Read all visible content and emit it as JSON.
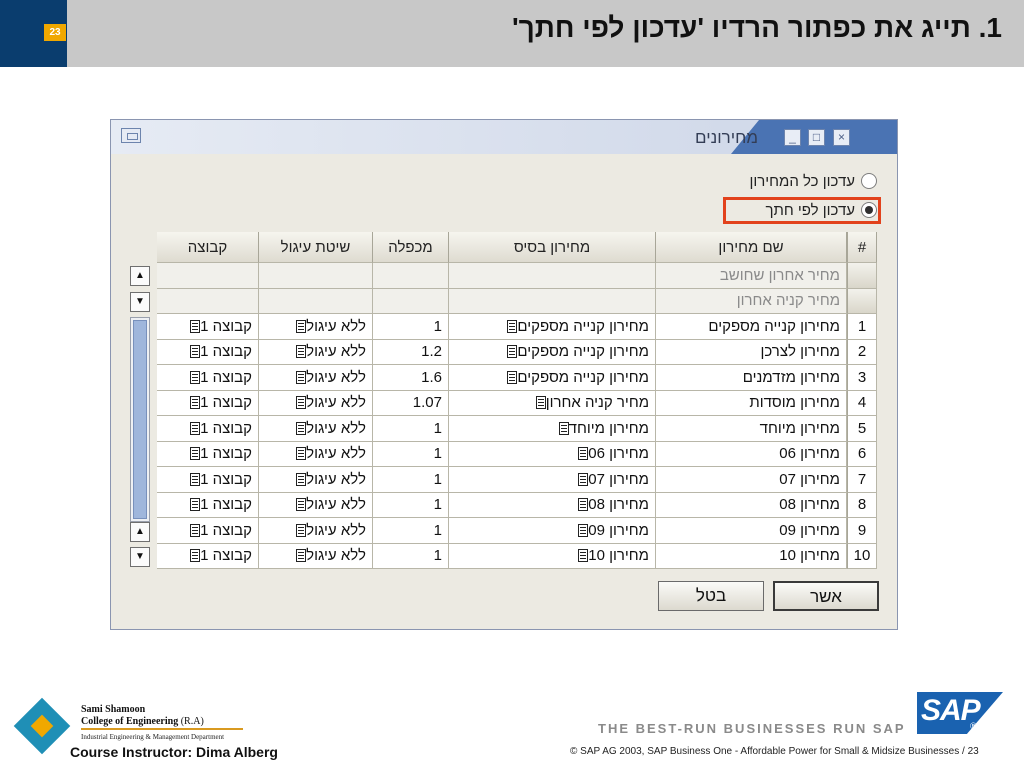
{
  "slide": {
    "page_number": "23",
    "title": "1. תייג את כפתור הרדיו 'עדכון לפי חתך'"
  },
  "window": {
    "title": "מחירונים",
    "minimize_icon": "minimize-icon",
    "restore_icon": "restore-icon",
    "close_icon": "close-icon",
    "radio_options": [
      {
        "label": "עדכון כל המחירון",
        "selected": false
      },
      {
        "label": "עדכון לפי חתך",
        "selected": true
      }
    ],
    "highlight_color": "#e2421c"
  },
  "grid": {
    "headers": {
      "num": "#",
      "name": "שם מחירון",
      "base": "מחירון בסיס",
      "factor": "מכפלה",
      "rounding": "שיטת עיגול",
      "group": "קבוצה"
    },
    "special_rows": [
      {
        "name": "מחיר אחרון שחושב"
      },
      {
        "name": "מחיר קניה אחרון"
      }
    ],
    "rows": [
      {
        "num": "1",
        "name": "מחירון קנייה מספקים",
        "base": "מחירון קנייה מספקים",
        "factor": "1",
        "rounding": "ללא עיגול",
        "group": "קבוצה 1"
      },
      {
        "num": "2",
        "name": "מחירון לצרכן",
        "base": "מחירון קנייה מספקים",
        "factor": "1.2",
        "rounding": "ללא עיגול",
        "group": "קבוצה 1"
      },
      {
        "num": "3",
        "name": "מחירון מזדמנים",
        "base": "מחירון קנייה מספקים",
        "factor": "1.6",
        "rounding": "ללא עיגול",
        "group": "קבוצה 1"
      },
      {
        "num": "4",
        "name": "מחירון מוסדות",
        "base": "מחיר קניה אחרון",
        "factor": "1.07",
        "rounding": "ללא עיגול",
        "group": "קבוצה 1"
      },
      {
        "num": "5",
        "name": "מחירון מיוחד",
        "base": "מחירון מיוחד",
        "factor": "1",
        "rounding": "ללא עיגול",
        "group": "קבוצה 1"
      },
      {
        "num": "6",
        "name": "מחירון 06",
        "base": "מחירון 06",
        "factor": "1",
        "rounding": "ללא עיגול",
        "group": "קבוצה 1"
      },
      {
        "num": "7",
        "name": "מחירון 07",
        "base": "מחירון 07",
        "factor": "1",
        "rounding": "ללא עיגול",
        "group": "קבוצה 1"
      },
      {
        "num": "8",
        "name": "מחירון 08",
        "base": "מחירון 08",
        "factor": "1",
        "rounding": "ללא עיגול",
        "group": "קבוצה 1"
      },
      {
        "num": "9",
        "name": "מחירון 09",
        "base": "מחירון 09",
        "factor": "1",
        "rounding": "ללא עיגול",
        "group": "קבוצה 1"
      },
      {
        "num": "10",
        "name": "מחירון 10",
        "base": "מחירון 10",
        "factor": "1",
        "rounding": "ללא עיגול",
        "group": "קבוצה 1"
      }
    ]
  },
  "buttons": {
    "ok": "אשר",
    "cancel": "בטל"
  },
  "footer": {
    "author": "Sami Shamoon",
    "college": "College of Engineering",
    "college_suffix": "(R.A)",
    "department": "Industrial Engineering & Management Department",
    "instructor": "Course Instructor: Dima Alberg",
    "tagline": "THE BEST-RUN BUSINESSES RUN SAP",
    "sap_logo": "SAP",
    "sap_registered": "®",
    "copyright": "© SAP AG 2003, SAP Business One - Affordable Power for Small & Midsize Businesses / 23"
  },
  "colors": {
    "header_bar": "#c8c8c8",
    "header_block": "#0a3d6e",
    "page_badge": "#f0a800",
    "window_titlebar": "#4a73b3",
    "sap_blue": "#1a62b0"
  }
}
